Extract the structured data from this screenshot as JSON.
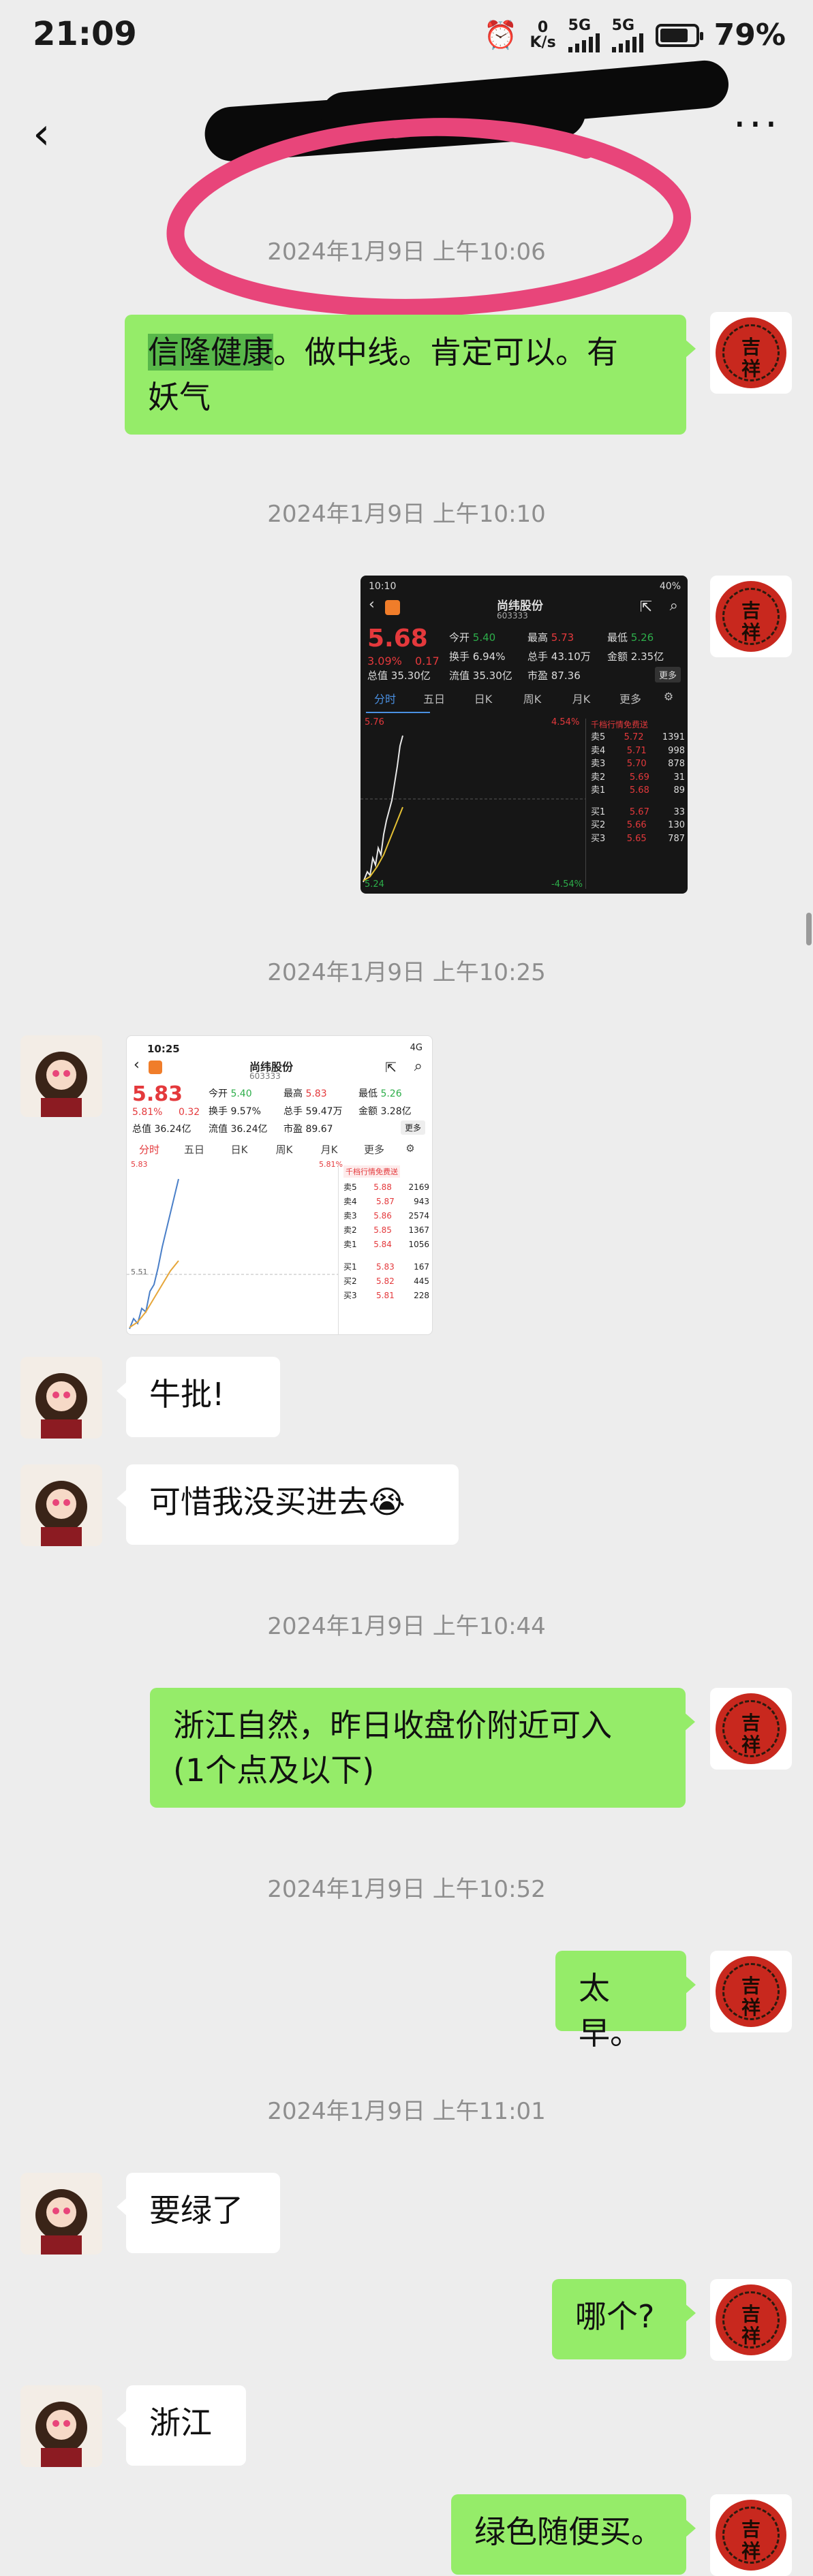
{
  "status_bar": {
    "time": "21:09",
    "net_speed_value": "0",
    "net_speed_unit": "K/s",
    "sig1": "5G",
    "sig2": "5G",
    "battery": "79%"
  },
  "nav": {
    "back": "‹",
    "more": "···"
  },
  "timestamps": [
    "2024年1月9日 上午10:06",
    "2024年1月9日 上午10:10",
    "2024年1月9日 上午10:25",
    "2024年1月9日 上午10:44",
    "2024年1月9日 上午10:52",
    "2024年1月9日 上午11:01"
  ],
  "avatar_chars": [
    "吉",
    "祥"
  ],
  "messages": {
    "m1_hl": "信隆健康",
    "m1_line1": "。做中线。肯定可以。有",
    "m1_line2": "妖气",
    "m3": "牛批!",
    "m4": "可惜我没买进去😭",
    "m5_line1": "浙江自然，昨日收盘价附近可入",
    "m5_line2": "(1个点及以下)",
    "m6": "太早。",
    "m7": "要绿了",
    "m8": "哪个?",
    "m9": "浙江",
    "m10": "绿色随便买。"
  },
  "shot1": {
    "time": "10:10",
    "battery": "40%",
    "name": "尚纬股份",
    "code": "603333",
    "price": "5.68",
    "change_pct": "3.09%",
    "change_abs": "0.17",
    "today_open_label": "今开",
    "today_open": "5.40",
    "high_label": "最高",
    "high": "5.73",
    "low_label": "最低",
    "low": "5.26",
    "turnover_label": "换手",
    "turnover": "6.94%",
    "volume_label": "总手",
    "volume": "43.10万",
    "amount_label": "金额",
    "amount": "2.35亿",
    "total_cap_label": "总值",
    "total_cap": "35.30亿",
    "float_cap_label": "流值",
    "float_cap": "35.30亿",
    "pe_label": "市盈",
    "pe": "87.36",
    "more": "更多",
    "tabs": [
      "分时",
      "五日",
      "日K",
      "周K",
      "月K",
      "更多"
    ],
    "upper_pct": "4.54%",
    "lower_pct": "-4.54%",
    "price_top": "5.76",
    "price_bottom": "5.24",
    "book_title": "千档行情免费送",
    "book": [
      [
        "卖5",
        "5.72",
        "1391"
      ],
      [
        "卖4",
        "5.71",
        "998"
      ],
      [
        "卖3",
        "5.70",
        "878"
      ],
      [
        "卖2",
        "5.69",
        "31"
      ],
      [
        "卖1",
        "5.68",
        "89"
      ],
      [
        "买1",
        "5.67",
        "33"
      ],
      [
        "买2",
        "5.66",
        "130"
      ],
      [
        "买3",
        "5.65",
        "787"
      ]
    ]
  },
  "shot2": {
    "time": "10:25",
    "battery": "4G",
    "name": "尚纬股份",
    "code": "603333",
    "price": "5.83",
    "change_pct": "5.81%",
    "change_abs": "0.32",
    "today_open_label": "今开",
    "today_open": "5.40",
    "high_label": "最高",
    "high": "5.83",
    "low_label": "最低",
    "low": "5.26",
    "turnover_label": "换手",
    "turnover": "9.57%",
    "volume_label": "总手",
    "volume": "59.47万",
    "amount_label": "金额",
    "amount": "3.28亿",
    "total_cap_label": "总值",
    "total_cap": "36.24亿",
    "float_cap_label": "流值",
    "float_cap": "36.24亿",
    "pe_label": "市盈",
    "pe": "89.67",
    "more": "更多",
    "tabs": [
      "分时",
      "五日",
      "日K",
      "周K",
      "月K",
      "更多"
    ],
    "upper_pct": "5.81%",
    "mid_price": "5.51",
    "price_top": "5.83",
    "book_title": "千档行情免费送",
    "book": [
      [
        "卖5",
        "5.88",
        "2169"
      ],
      [
        "卖4",
        "5.87",
        "943"
      ],
      [
        "卖3",
        "5.86",
        "2574"
      ],
      [
        "卖2",
        "5.85",
        "1367"
      ],
      [
        "卖1",
        "5.84",
        "1056"
      ],
      [
        "买1",
        "5.83",
        "167"
      ],
      [
        "买2",
        "5.82",
        "445"
      ],
      [
        "买3",
        "5.81",
        "228"
      ]
    ]
  },
  "colors": {
    "bg": "#ededed",
    "me_bubble": "#95ec69",
    "them_bubble": "#ffffff",
    "timestamp": "#8e8e8e",
    "annotation": "#e8457a"
  }
}
